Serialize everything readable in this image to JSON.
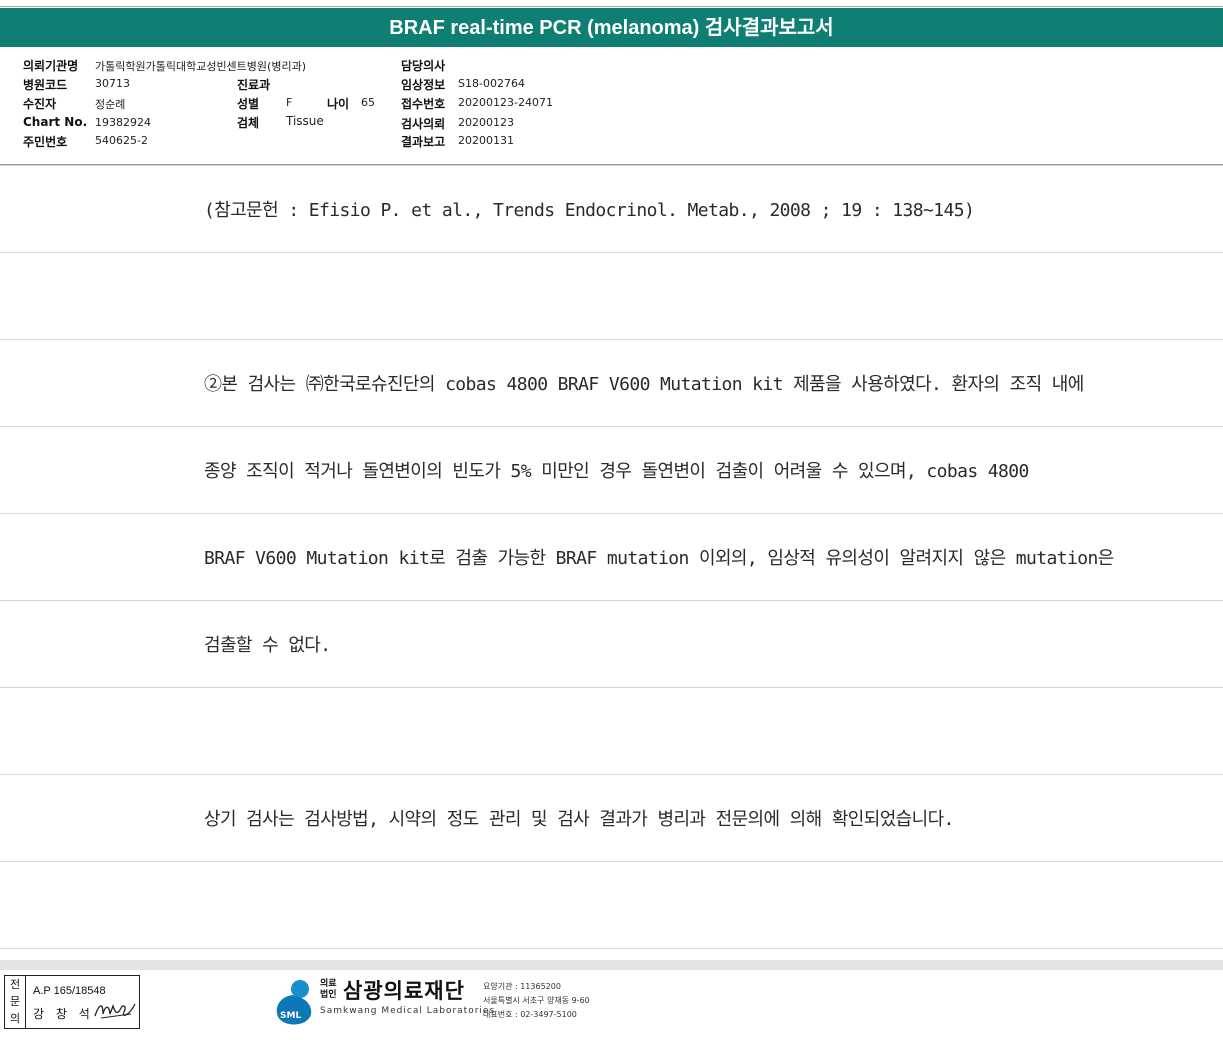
{
  "title": "BRAF real-time PCR (melanoma) 검사결과보고서",
  "info": {
    "institution_label": "의뢰기관명",
    "institution_value": "가톨릭학원가톨릭대학교성빈센트병원(병리과)",
    "hospital_code_label": "병원코드",
    "hospital_code_value": "30713",
    "patient_label": "수진자",
    "patient_value": "정순례",
    "chart_label": "Chart No.",
    "chart_value": "19382924",
    "resident_label": "주민번호",
    "resident_value": "540625-2",
    "department_label": "진료과",
    "department_value": "",
    "sex_label": "성별",
    "sex_value": "F",
    "age_label": "나이",
    "age_value": "65",
    "specimen_label": "검체",
    "specimen_value": "Tissue",
    "doctor_label": "담당의사",
    "doctor_value": "",
    "clinical_label": "임상정보",
    "clinical_value": "S18-002764",
    "receipt_label": "접수번호",
    "receipt_value": "20200123-24071",
    "request_label": "검사의뢰",
    "request_value": "20200123",
    "report_label": "결과보고",
    "report_value": "20200131"
  },
  "body_lines": [
    "(참고문헌 : Efisio P. et al., Trends Endocrinol. Metab., 2008 ; 19 : 138~145)",
    "",
    "②본 검사는 ㈜한국로슈진단의 cobas 4800 BRAF V600 Mutation kit 제품을 사용하였다. 환자의 조직 내에",
    "종양 조직이 적거나 돌연변이의 빈도가 5% 미만인 경우 돌연변이 검출이 어려울 수 있으며, cobas 4800",
    "BRAF V600 Mutation kit로 검출 가능한 BRAF mutation 이외의, 임상적 유의성이 알려지지 않은 mutation은",
    "검출할 수 없다.",
    "",
    "상기 검사는 검사방법, 시약의 정도 관리 및 검사 결과가 병리과 전문의에 의해 확인되었습니다.",
    ""
  ],
  "footer": {
    "specialist_side": "전문의",
    "ap_number": "A.P 165/18548",
    "signer_name": "강 창 석",
    "foundation_small": "의료\n법인",
    "foundation_name": "삼광의료재단",
    "foundation_en": "Samkwang Medical Laboratories",
    "logo_text": "SML",
    "addr_line1": "요양기관 : 11365200",
    "addr_line2": "서울특별시 서초구 양재동 9-60",
    "addr_line3": "대표번호 : 02-3497-5100"
  },
  "colors": {
    "title_bar": "#0f7f73"
  }
}
